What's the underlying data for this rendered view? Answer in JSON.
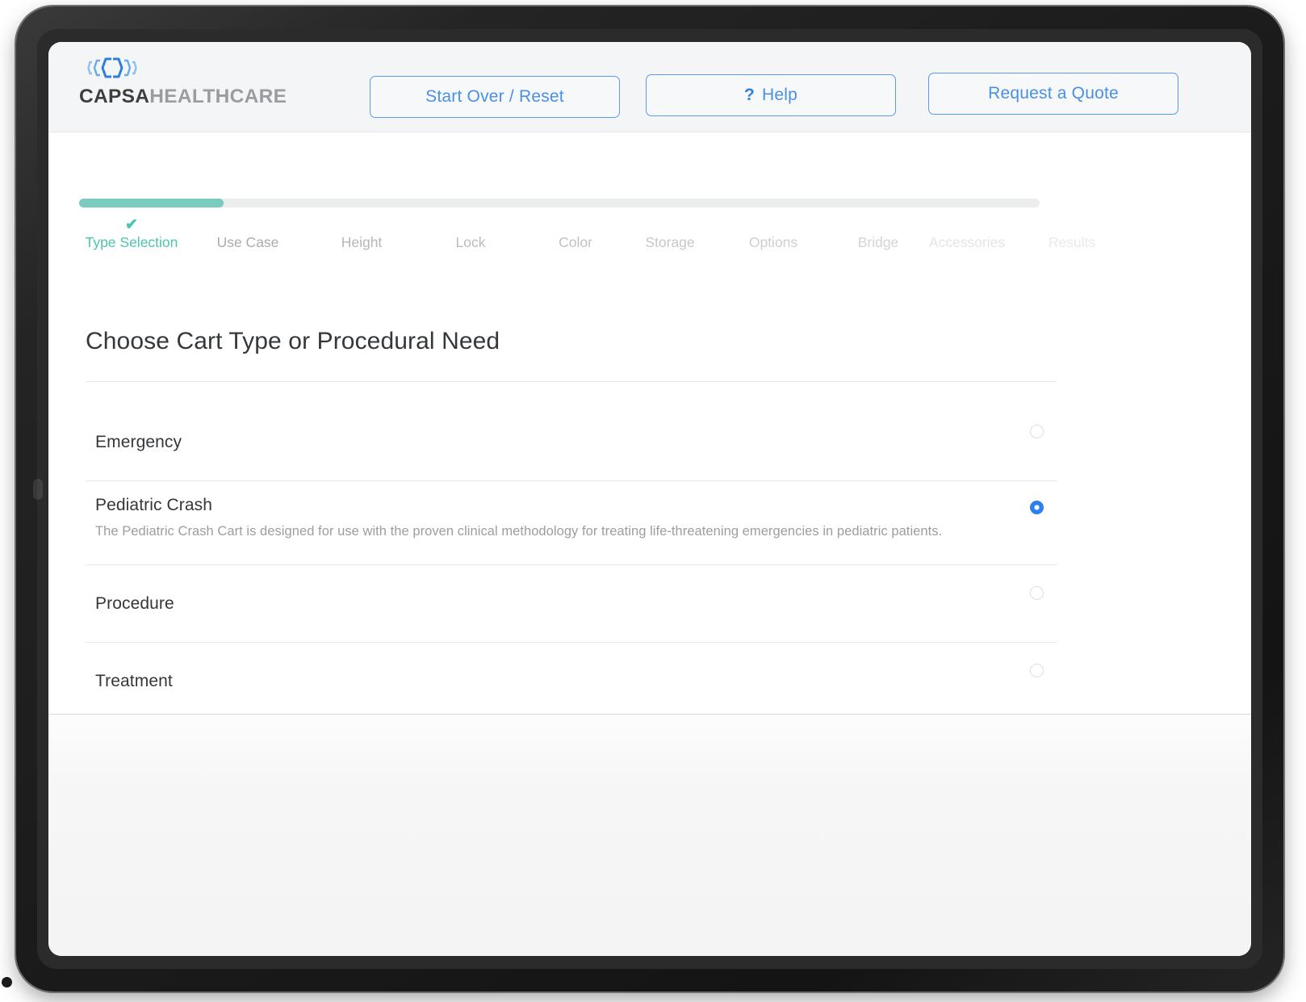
{
  "brand": {
    "logo_icon": "capsa-bracket-logo",
    "name_primary": "CAPSA",
    "name_secondary": "HEALTHCARE"
  },
  "header": {
    "buttons": {
      "start_over": "Start Over / Reset",
      "help": "Help",
      "help_icon": "question-mark-icon",
      "request_quote": "Request a Quote"
    }
  },
  "progress": {
    "percent": 15,
    "fill_color": "#79ccbf",
    "track_color": "#eceded",
    "check_icon": "checkmark-icon",
    "steps": [
      {
        "label": "Type Selection",
        "state": "current",
        "color": "#4cc4b0"
      },
      {
        "label": "Use Case",
        "state": "upcoming",
        "color": "#a9acae"
      },
      {
        "label": "Height",
        "state": "upcoming",
        "color": "#b4b7b9"
      },
      {
        "label": "Lock",
        "state": "upcoming",
        "color": "#b9bcbe"
      },
      {
        "label": "Color",
        "state": "upcoming",
        "color": "#bfc2c4"
      },
      {
        "label": "Storage",
        "state": "upcoming",
        "color": "#c6c8ca"
      },
      {
        "label": "Options",
        "state": "upcoming",
        "color": "#ccced0"
      },
      {
        "label": "Bridge",
        "state": "upcoming",
        "color": "#d2d4d6"
      },
      {
        "label": "Accessories",
        "state": "upcoming",
        "color": "#e3e4e5"
      },
      {
        "label": "Results",
        "state": "upcoming",
        "color": "#e9eaeb"
      }
    ]
  },
  "main": {
    "title": "Choose Cart Type or Procedural Need",
    "options": [
      {
        "label": "Emergency",
        "description": "",
        "selected": false
      },
      {
        "label": "Pediatric Crash",
        "description": "The Pediatric Crash Cart is designed for use with the proven clinical methodology for treating life-threatening emergencies in pediatric patients.",
        "selected": true
      },
      {
        "label": "Procedure",
        "description": "",
        "selected": false
      },
      {
        "label": "Treatment",
        "description": "",
        "selected": false
      }
    ]
  },
  "colors": {
    "accent_blue": "#4a90e2",
    "selected_radio": "#2d7ff0",
    "teal": "#79ccbf",
    "header_bg": "#f4f5f6"
  }
}
